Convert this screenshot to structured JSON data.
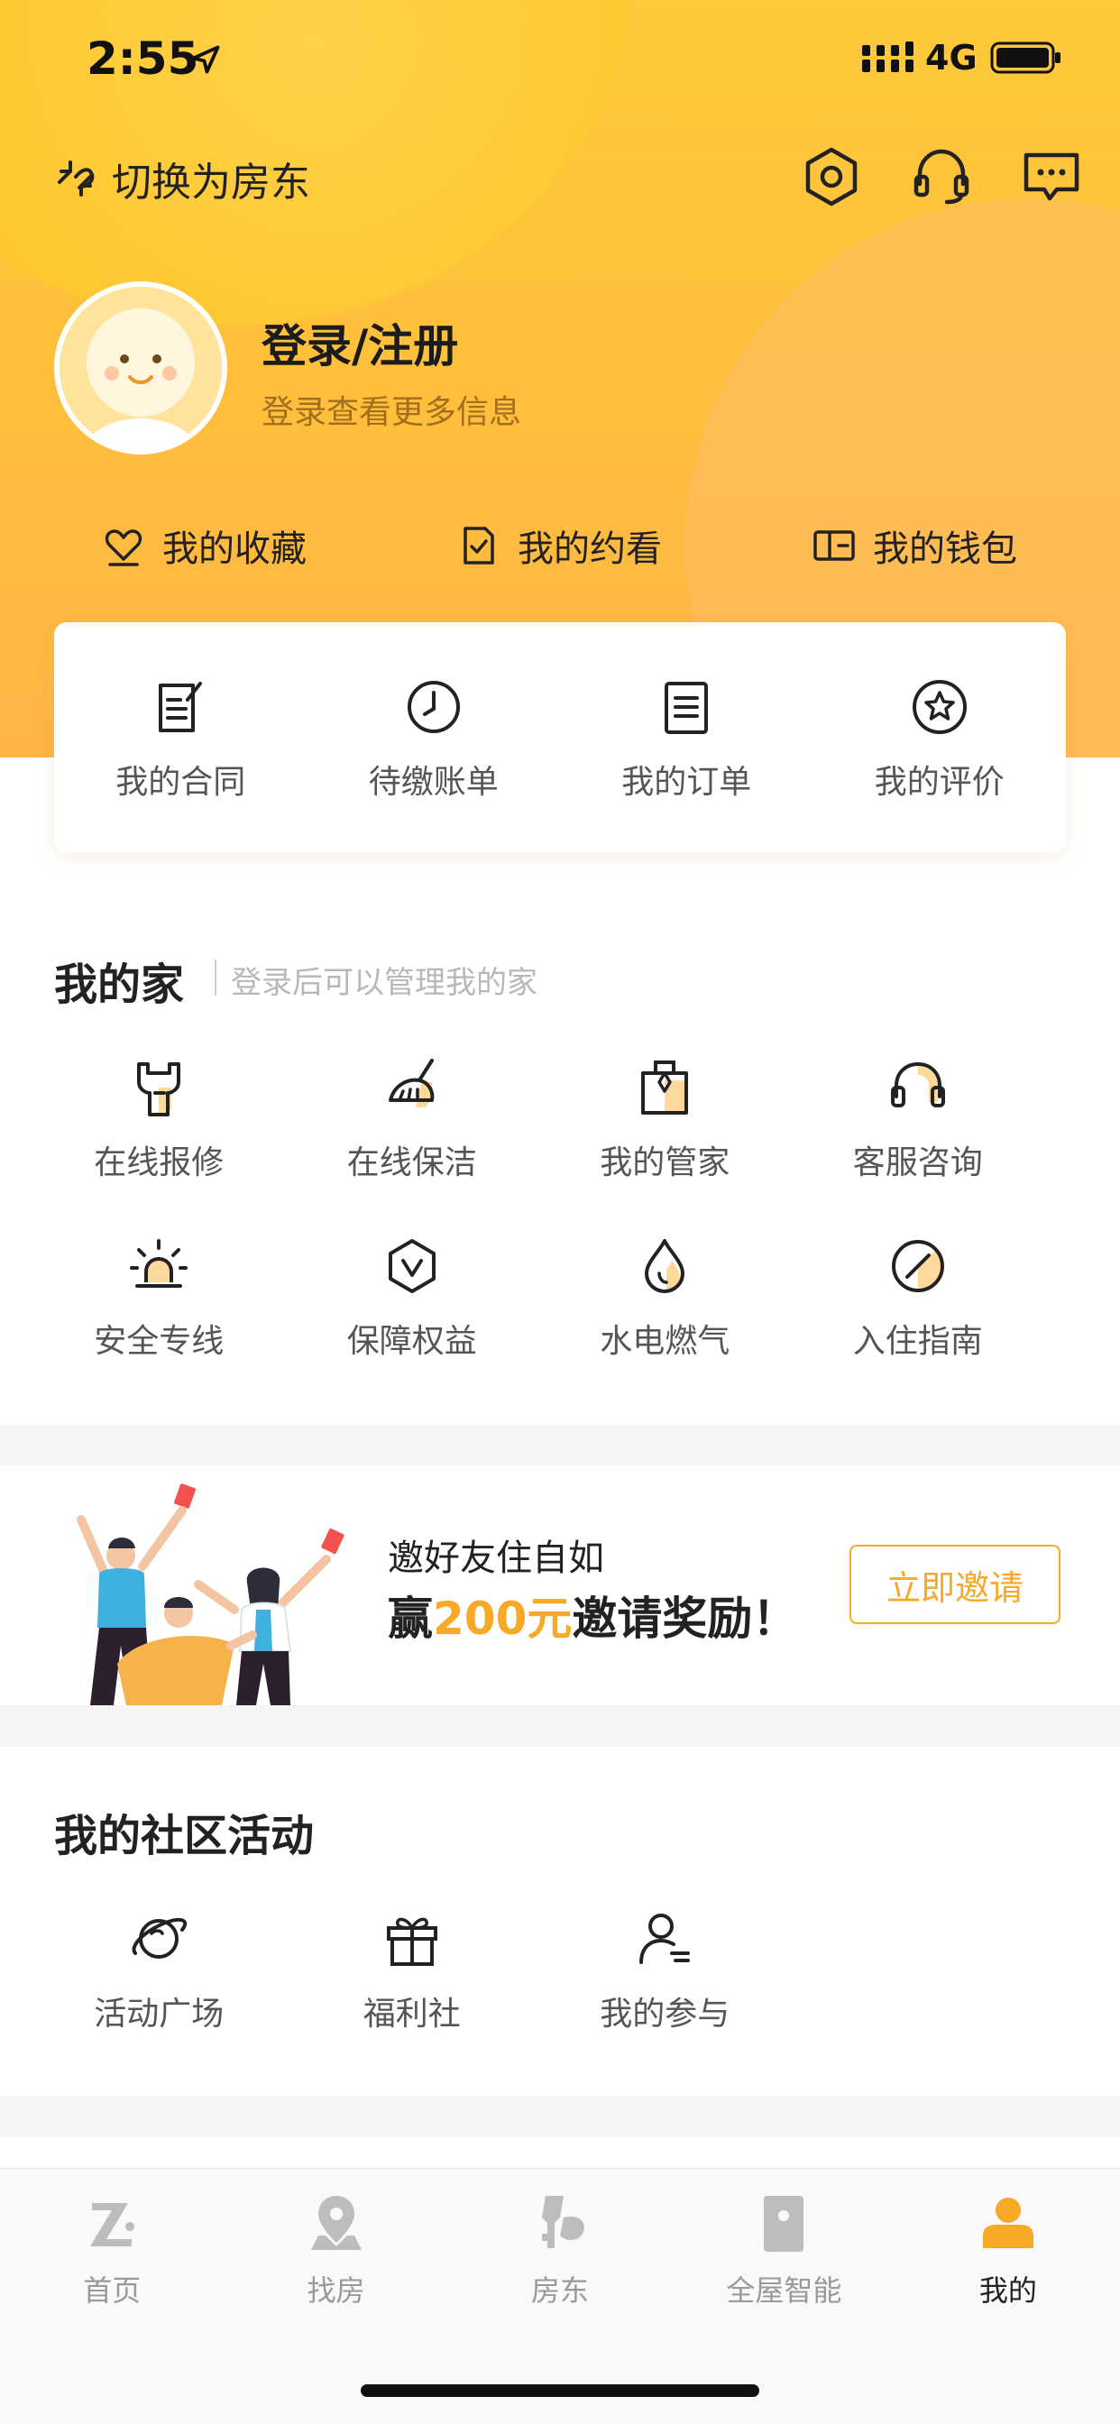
{
  "status_bar": {
    "time": "2:55",
    "network": "4G"
  },
  "header": {
    "switch_role_label": "切换为房东",
    "icons": [
      "settings-icon",
      "customer-service-icon",
      "message-icon"
    ]
  },
  "profile": {
    "login_title": "登录/注册",
    "login_subtitle": "登录查看更多信息"
  },
  "quick_links": [
    {
      "label": "我的收藏",
      "icon": "heart-icon"
    },
    {
      "label": "我的约看",
      "icon": "check-document-icon"
    },
    {
      "label": "我的钱包",
      "icon": "wallet-icon"
    }
  ],
  "card_items": [
    {
      "label": "我的合同",
      "icon": "contract-icon"
    },
    {
      "label": "待缴账单",
      "icon": "clock-icon"
    },
    {
      "label": "我的订单",
      "icon": "order-icon"
    },
    {
      "label": "我的评价",
      "icon": "star-icon"
    }
  ],
  "my_home": {
    "title": "我的家",
    "subtitle": "登录后可以管理我的家",
    "items": [
      {
        "label": "在线报修",
        "icon": "repair-icon"
      },
      {
        "label": "在线保洁",
        "icon": "cleaning-icon"
      },
      {
        "label": "我的管家",
        "icon": "butler-icon"
      },
      {
        "label": "客服咨询",
        "icon": "headset-icon"
      },
      {
        "label": "安全专线",
        "icon": "alarm-icon"
      },
      {
        "label": "保障权益",
        "icon": "shield-icon"
      },
      {
        "label": "水电燃气",
        "icon": "utilities-icon"
      },
      {
        "label": "入住指南",
        "icon": "compass-icon"
      }
    ]
  },
  "invite_banner": {
    "line1": "邀好友住自如",
    "line2_prefix": "赢",
    "line2_highlight": "200元",
    "line2_suffix": "邀请奖励！",
    "button_label": "立即邀请"
  },
  "community": {
    "title": "我的社区活动",
    "items": [
      {
        "label": "活动广场",
        "icon": "planet-icon"
      },
      {
        "label": "福利社",
        "icon": "gift-icon"
      },
      {
        "label": "我的参与",
        "icon": "user-list-icon"
      }
    ]
  },
  "tab_bar": {
    "tabs": [
      {
        "label": "首页",
        "icon": "home-logo-icon",
        "active": false
      },
      {
        "label": "找房",
        "icon": "location-pin-icon",
        "active": false
      },
      {
        "label": "房东",
        "icon": "key-icon",
        "active": false
      },
      {
        "label": "全屋智能",
        "icon": "smart-device-icon",
        "active": false
      },
      {
        "label": "我的",
        "icon": "profile-icon",
        "active": true
      }
    ]
  },
  "colors": {
    "accent": "#f7a928",
    "header_gradient_top": "#ffc93a",
    "header_gradient_bottom": "#ffb547",
    "icon_fill": "#ffd89b"
  }
}
